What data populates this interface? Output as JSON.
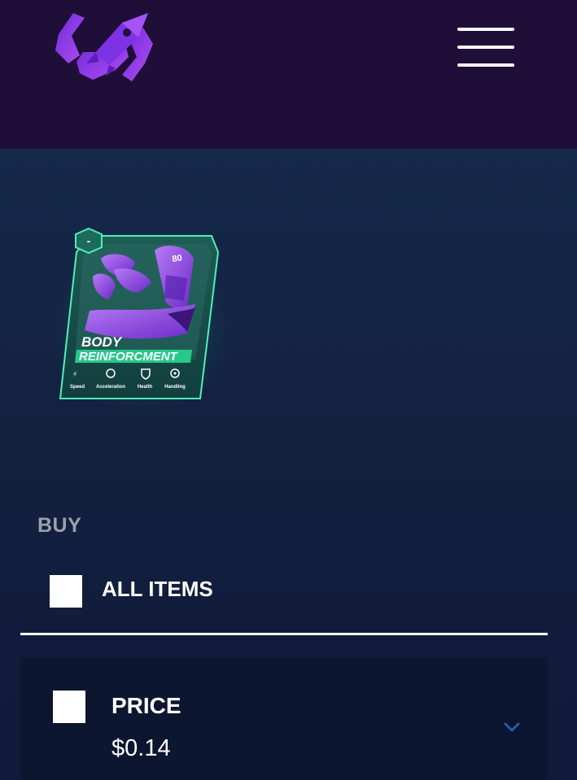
{
  "header": {
    "logo_icon": "rocket-shield-logo",
    "menu_icon": "hamburger-menu-icon"
  },
  "card": {
    "badge": "-",
    "level": "80",
    "title_line1": "BODY",
    "title_line2": "REINFORCMENT",
    "stats": [
      {
        "icon": "lightning-icon",
        "label": "Speed"
      },
      {
        "icon": "gauge-icon",
        "label": "Acceleration"
      },
      {
        "icon": "health-shield-icon",
        "label": "Health"
      },
      {
        "icon": "steering-wheel-icon",
        "label": "Handling"
      }
    ]
  },
  "buy": {
    "heading": "BUY",
    "all_items_label": "ALL ITEMS"
  },
  "listing": {
    "price_label": "PRICE",
    "price_value": "$0.14",
    "expand_icon": "chevron-down-icon"
  },
  "colors": {
    "header_bg": "#1f0f38",
    "page_bg": "#13213f",
    "card_accent": "#2ee6a8",
    "logo_purple": "#8a3cf0",
    "chevron": "#2a5aa8"
  }
}
